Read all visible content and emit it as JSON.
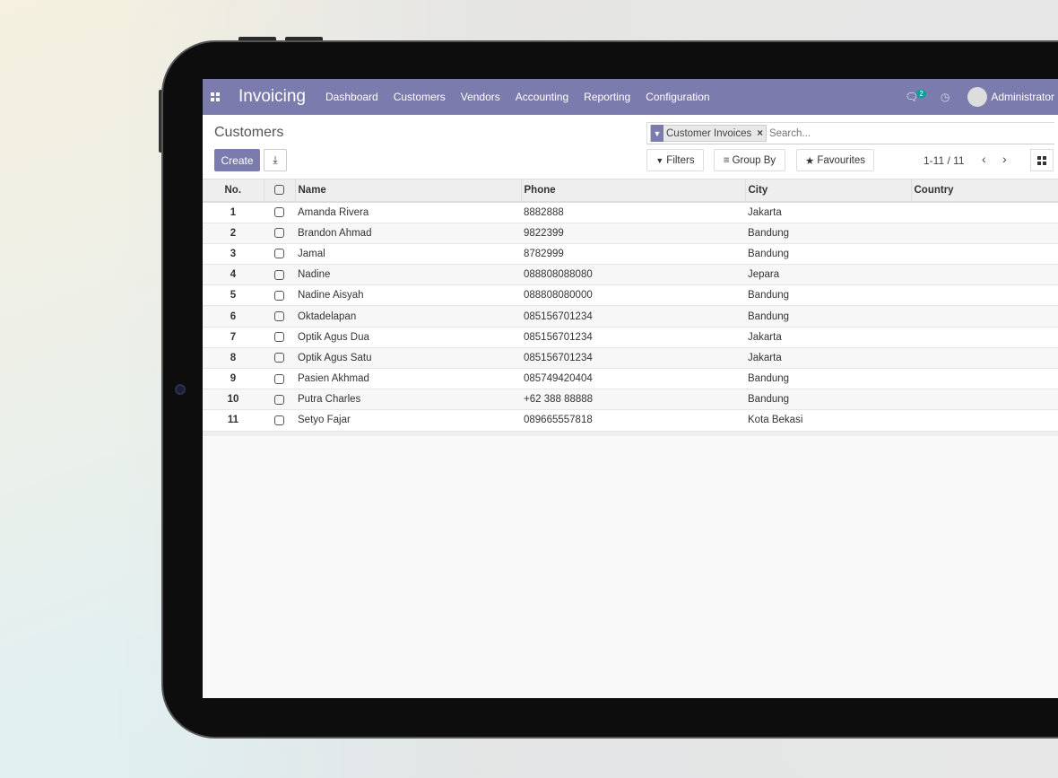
{
  "app": {
    "title": "Invoicing",
    "menu": [
      "Dashboard",
      "Customers",
      "Vendors",
      "Accounting",
      "Reporting",
      "Configuration"
    ],
    "message_count": "2",
    "user": "Administrator",
    "accent": "#7c7bad"
  },
  "control_panel": {
    "breadcrumb": "Customers",
    "create_label": "Create",
    "facet": "Customer Invoices",
    "search_placeholder": "Search...",
    "filters": "Filters",
    "group_by": "Group By",
    "favourites": "Favourites",
    "pager": "1-11 / 11"
  },
  "table": {
    "columns": [
      "No.",
      "Name",
      "Phone",
      "City",
      "Country"
    ],
    "rows": [
      {
        "no": "1",
        "name": "Amanda Rivera",
        "phone": "8882888",
        "city": "Jakarta",
        "country": ""
      },
      {
        "no": "2",
        "name": "Brandon Ahmad",
        "phone": "9822399",
        "city": "Bandung",
        "country": ""
      },
      {
        "no": "3",
        "name": "Jamal",
        "phone": "8782999",
        "city": "Bandung",
        "country": ""
      },
      {
        "no": "4",
        "name": "Nadine",
        "phone": "088808088080",
        "city": "Jepara",
        "country": ""
      },
      {
        "no": "5",
        "name": "Nadine Aisyah",
        "phone": "088808080000",
        "city": "Bandung",
        "country": ""
      },
      {
        "no": "6",
        "name": "Oktadelapan",
        "phone": "085156701234",
        "city": "Bandung",
        "country": ""
      },
      {
        "no": "7",
        "name": "Optik Agus Dua",
        "phone": "085156701234",
        "city": "Jakarta",
        "country": ""
      },
      {
        "no": "8",
        "name": "Optik Agus Satu",
        "phone": "085156701234",
        "city": "Jakarta",
        "country": ""
      },
      {
        "no": "9",
        "name": "Pasien Akhmad",
        "phone": "085749420404",
        "city": "Bandung",
        "country": ""
      },
      {
        "no": "10",
        "name": "Putra Charles",
        "phone": "+62 388 88888",
        "city": "Bandung",
        "country": ""
      },
      {
        "no": "11",
        "name": "Setyo Fajar",
        "phone": "089665557818",
        "city": "Kota Bekasi",
        "country": ""
      }
    ]
  }
}
